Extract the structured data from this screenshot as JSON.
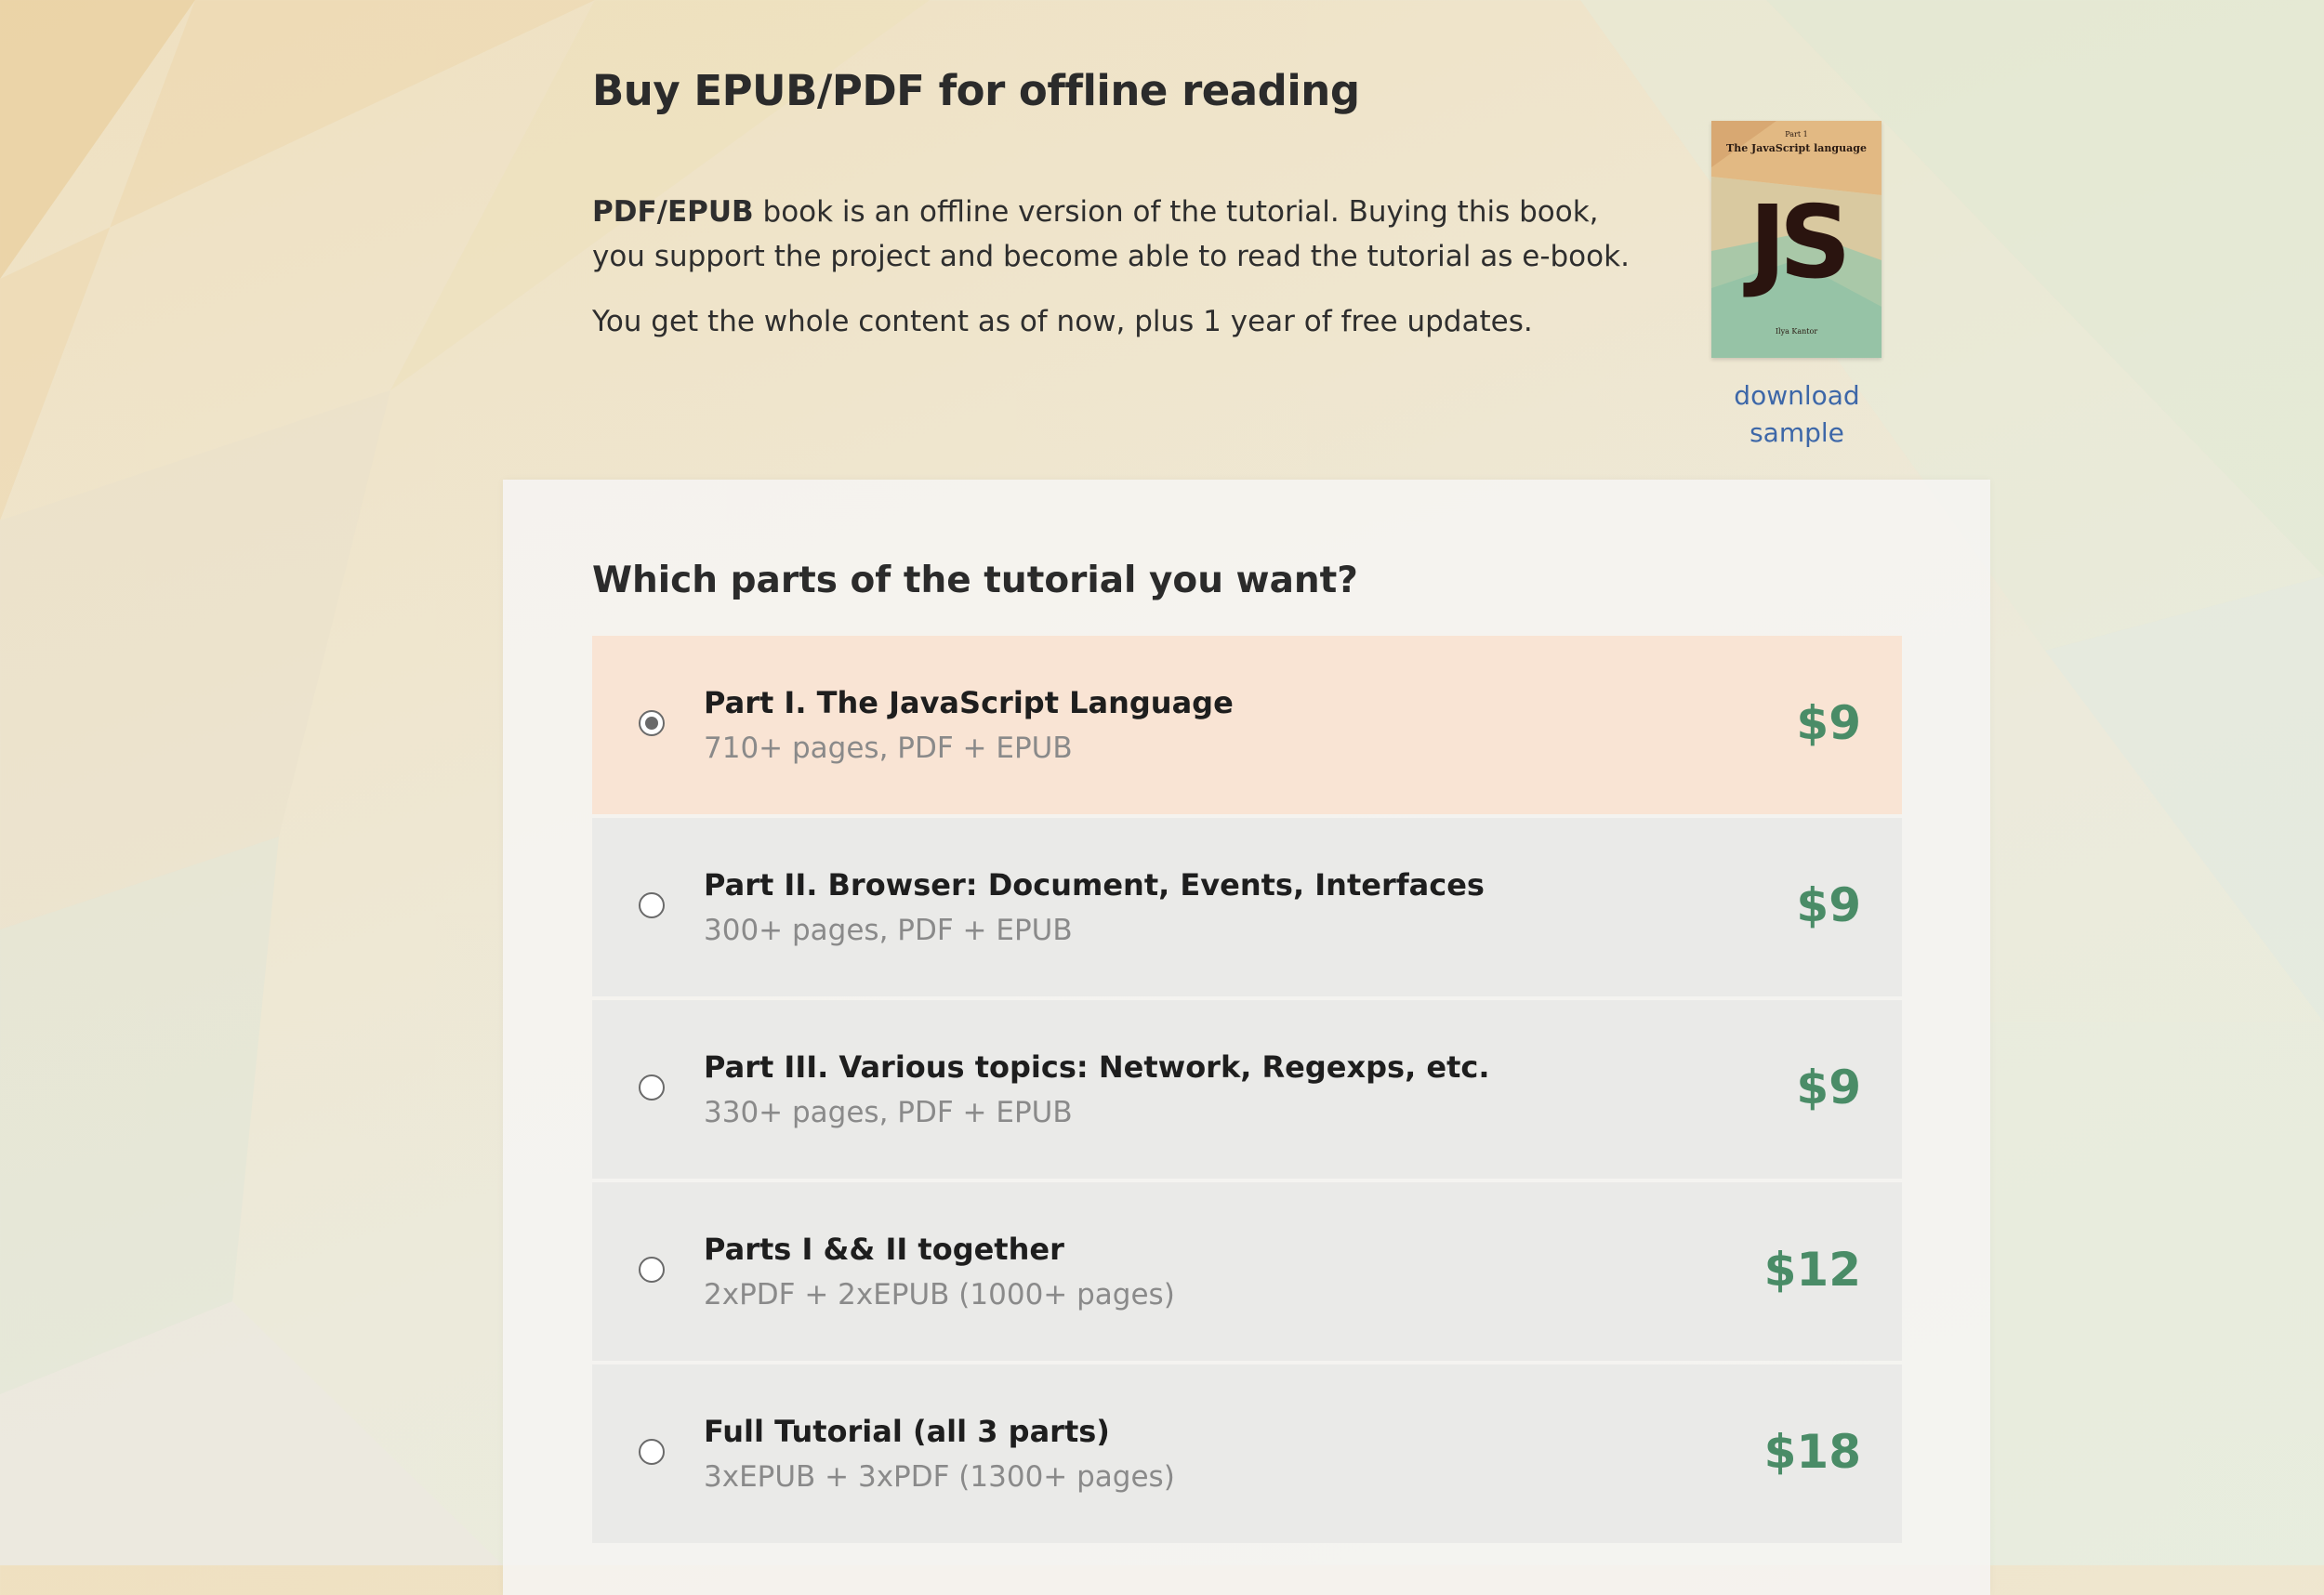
{
  "heading": "Buy EPUB/PDF for offline reading",
  "intro": {
    "bold": "PDF/EPUB",
    "text": " book is an offline version of the tutorial. Buying this book, you support the project and become able to read the tutorial as e-book.",
    "updates": "You get the whole content as of now, plus 1 year of free updates."
  },
  "cover": {
    "part": "Part 1",
    "title": "The JavaScript language",
    "logo": "JS",
    "author": "Ilya Kantor"
  },
  "download_sample": "download sample",
  "question": "Which parts of the tutorial you want?",
  "selected_index": 0,
  "options": [
    {
      "title": "Part I. The JavaScript Language",
      "subtitle": "710+ pages, PDF + EPUB",
      "price": "$9"
    },
    {
      "title": "Part II. Browser: Document, Events, Interfaces",
      "subtitle": "300+ pages, PDF + EPUB",
      "price": "$9"
    },
    {
      "title": "Part III. Various topics: Network, Regexps, etc.",
      "subtitle": "330+ pages, PDF + EPUB",
      "price": "$9"
    },
    {
      "title": "Parts I && II together",
      "subtitle": "2xPDF + 2xEPUB (1000+ pages)",
      "price": "$12"
    },
    {
      "title": "Full Tutorial (all 3 parts)",
      "subtitle": "3xEPUB + 3xPDF (1300+ pages)",
      "price": "$18"
    }
  ],
  "colors": {
    "price": "#4a8c67",
    "link": "#3d67a8",
    "selected_row": "#fae2d0"
  }
}
